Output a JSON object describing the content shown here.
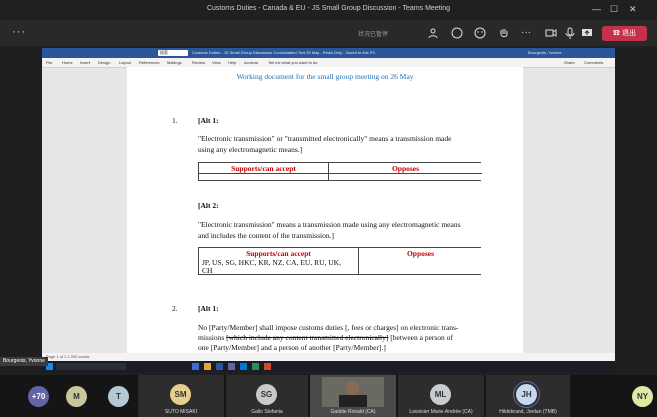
{
  "window": {
    "title": "Customs Duties - Canada & EU - JS Small Group Discussion - Teams Meeting",
    "minimize": "—",
    "maximize": "☐",
    "close": "✕"
  },
  "toolbar": {
    "menu_dots": "···",
    "status_text": "状况已暂停",
    "leave_label": "退出"
  },
  "word": {
    "search_box": "搜索",
    "title_text": "Customs Duties - JS Small Group Discussion Consolidated Text 25 May - Read-Only - Saved to this PC",
    "user": "Bourgeois, Yvonne",
    "ribbon": [
      "File",
      "Home",
      "Insert",
      "Design",
      "Layout",
      "References",
      "Mailings",
      "Review",
      "View",
      "Help",
      "Acrobat",
      "Tell me what you want to do"
    ],
    "ribbon_right": [
      "Share",
      "Comments"
    ],
    "status_left": "Page 1 of 2   1,050 words"
  },
  "doc": {
    "heading": "Working document for the small group meeting on 26 May",
    "item1_num": "1.",
    "alt1_label": "[Alt 1:",
    "alt1_text_a": "\"Electronic transmission\" or \"transmitted electronically\" means a transmission made",
    "alt1_text_b": "using any electromagnetic means.]",
    "col_supports": "Supports/can accept",
    "col_opposes": "Opposes",
    "alt2_label": "[Alt 2:",
    "alt2_text_a": "\"Electronic transmission\" means a transmission made using any electromagnetic means",
    "alt2_text_b": "and includes the content of the transmission.]",
    "alt2_supporters_a": "JP, US, SG, HKC, KR, NZ, CA, EU, RU, UK,",
    "alt2_supporters_b": "CH",
    "item2_num": "2.",
    "item2_alt_label": "[Alt 1:",
    "item2_text_a": "No [Party/Member] shall impose customs duties [, fees or charges] on electronic trans-",
    "item2_text_b_plain": "missions",
    "item2_text_b_strike": "[which include any content transmitted electronically]",
    "item2_text_b_rest": "[between a person of",
    "item2_text_c": "one [Party/Member] and a person of another [Party/Member].]"
  },
  "presenter_label": "Bourgeois, Yvonne",
  "participants": [
    {
      "initials": "+70",
      "name": "",
      "color": "#6264a7"
    },
    {
      "initials": "M",
      "name": "",
      "color": "#c8c69a"
    },
    {
      "initials": "T",
      "name": "",
      "color": "#b5c8d6"
    },
    {
      "initials": "SM",
      "name": "SUTO MISAKI",
      "color": "#e6cf8e"
    },
    {
      "initials": "SG",
      "name": "Gallo Stefania",
      "color": "#c9c9c9"
    },
    {
      "initials": "",
      "name": "Gaddie Ronald (CA)",
      "color": "#000000"
    },
    {
      "initials": "ML",
      "name": "Lavoisier Marie-Andrée (CA)",
      "color": "#c8cbd0"
    },
    {
      "initials": "JH",
      "name": "Hildebrand, Jordan (TMB)",
      "color": "#c6d8ee"
    },
    {
      "initials": "NY",
      "name": "",
      "color": "#dfe9a6"
    }
  ]
}
